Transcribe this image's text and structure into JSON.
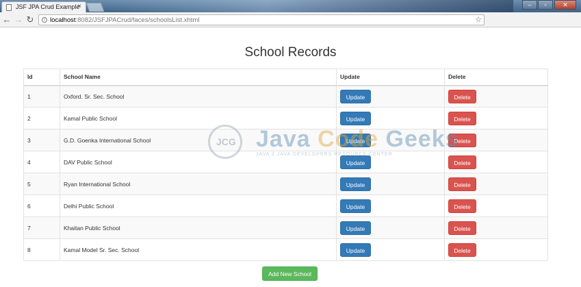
{
  "browser": {
    "tab_title": "JSF JPA Crud Example",
    "tab_close": "×",
    "url_host": "localhost",
    "url_rest": ":8082/JSFJPACrud/faces/schoolsList.xhtml"
  },
  "icons": {
    "back": "arrow-left-icon",
    "forward": "arrow-right-icon",
    "reload": "reload-icon",
    "star": "star-icon",
    "page": "page-icon"
  },
  "page": {
    "title": "School Records",
    "add_button": "Add New School"
  },
  "table": {
    "headers": [
      "Id",
      "School Name",
      "Update",
      "Delete"
    ],
    "rows": [
      {
        "id": "1",
        "name": "Oxford. Sr. Sec. School",
        "update": "Update",
        "delete": "Delete"
      },
      {
        "id": "2",
        "name": "Kamal Public School",
        "update": "Update",
        "delete": "Delete"
      },
      {
        "id": "3",
        "name": "G.D. Goenka International School",
        "update": "Update",
        "delete": "Delete"
      },
      {
        "id": "4",
        "name": "DAV Public School",
        "update": "Update",
        "delete": "Delete"
      },
      {
        "id": "5",
        "name": "Ryan International School",
        "update": "Update",
        "delete": "Delete"
      },
      {
        "id": "6",
        "name": "Delhi Public School",
        "update": "Update",
        "delete": "Delete"
      },
      {
        "id": "7",
        "name": "Khaitan Public School",
        "update": "Update",
        "delete": "Delete"
      },
      {
        "id": "8",
        "name": "Kamal Model Sr. Sec. School",
        "update": "Update",
        "delete": "Delete"
      }
    ]
  },
  "watermark": {
    "emblem": "JCG",
    "name_part1": "Java ",
    "name_part2": "Code ",
    "name_part3": "Geeks",
    "tagline": "JAVA 2 JAVA DEVELOPERS RESOURCE CENTER"
  },
  "colors": {
    "update_button": "#337ab7",
    "delete_button": "#d9534f",
    "add_button": "#5cb85c"
  }
}
